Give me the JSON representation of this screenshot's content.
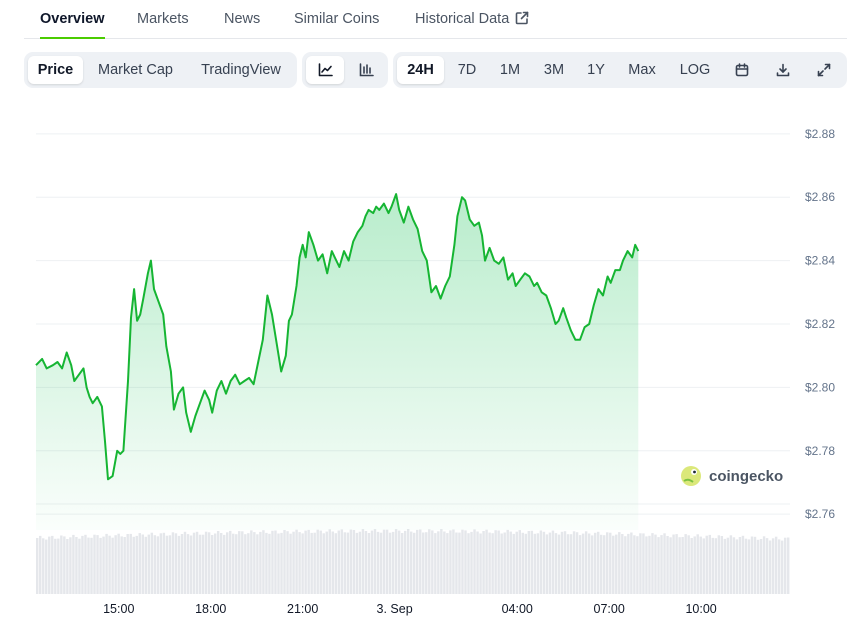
{
  "tabs": [
    {
      "label": "Overview",
      "active": true
    },
    {
      "label": "Markets",
      "active": false
    },
    {
      "label": "News",
      "active": false
    },
    {
      "label": "Similar Coins",
      "active": false
    },
    {
      "label": "Historical Data",
      "active": false,
      "external": true
    }
  ],
  "toolbar": {
    "chart_types": [
      {
        "label": "Price",
        "active": true
      },
      {
        "label": "Market Cap",
        "active": false
      },
      {
        "label": "TradingView",
        "active": false
      }
    ],
    "views": [
      {
        "icon": "line-chart-icon",
        "active": true
      },
      {
        "icon": "candlestick-chart-icon",
        "active": false
      }
    ],
    "ranges": [
      {
        "label": "24H",
        "active": true
      },
      {
        "label": "7D",
        "active": false
      },
      {
        "label": "1M",
        "active": false
      },
      {
        "label": "3M",
        "active": false
      },
      {
        "label": "1Y",
        "active": false
      },
      {
        "label": "Max",
        "active": false
      },
      {
        "label": "LOG",
        "active": false
      }
    ],
    "actions": [
      "calendar-icon",
      "download-icon",
      "fullscreen-icon"
    ]
  },
  "watermark": "coingecko",
  "colors": {
    "line": "#16b533",
    "accent": "#4bcc00",
    "volume": "#e5e7eb"
  },
  "chart_data": {
    "type": "area",
    "title": "",
    "xlabel": "",
    "ylabel": "",
    "ylim": [
      2.755,
      2.885
    ],
    "yticks": [
      {
        "value": 2.88,
        "label": "$2.88"
      },
      {
        "value": 2.86,
        "label": "$2.86"
      },
      {
        "value": 2.84,
        "label": "$2.84"
      },
      {
        "value": 2.82,
        "label": "$2.82"
      },
      {
        "value": 2.8,
        "label": "$2.80"
      },
      {
        "value": 2.78,
        "label": "$2.78"
      },
      {
        "value": 2.76,
        "label": "$2.76"
      }
    ],
    "xlim": [
      12.3,
      36.9
    ],
    "xticks": [
      {
        "value": 15,
        "label": "15:00"
      },
      {
        "value": 18,
        "label": "18:00"
      },
      {
        "value": 21,
        "label": "21:00"
      },
      {
        "value": 24,
        "label": "3. Sep"
      },
      {
        "value": 28,
        "label": "04:00"
      },
      {
        "value": 31,
        "label": "07:00"
      },
      {
        "value": 34,
        "label": "10:00"
      }
    ],
    "grid": true,
    "series": [
      {
        "values": [
          [
            12.3,
            2.807
          ],
          [
            12.5,
            2.809
          ],
          [
            12.65,
            2.806
          ],
          [
            12.85,
            2.807
          ],
          [
            13.0,
            2.808
          ],
          [
            13.15,
            2.806
          ],
          [
            13.3,
            2.811
          ],
          [
            13.45,
            2.807
          ],
          [
            13.55,
            2.802
          ],
          [
            13.7,
            2.804
          ],
          [
            13.85,
            2.806
          ],
          [
            13.95,
            2.8
          ],
          [
            14.05,
            2.797
          ],
          [
            14.15,
            2.795
          ],
          [
            14.3,
            2.797
          ],
          [
            14.45,
            2.794
          ],
          [
            14.55,
            2.783
          ],
          [
            14.65,
            2.771
          ],
          [
            14.8,
            2.772
          ],
          [
            14.95,
            2.78
          ],
          [
            15.05,
            2.779
          ],
          [
            15.15,
            2.78
          ],
          [
            15.3,
            2.802
          ],
          [
            15.4,
            2.822
          ],
          [
            15.5,
            2.831
          ],
          [
            15.6,
            2.821
          ],
          [
            15.7,
            2.823
          ],
          [
            15.8,
            2.828
          ],
          [
            15.95,
            2.836
          ],
          [
            16.05,
            2.84
          ],
          [
            16.15,
            2.831
          ],
          [
            16.3,
            2.827
          ],
          [
            16.45,
            2.823
          ],
          [
            16.55,
            2.813
          ],
          [
            16.7,
            2.805
          ],
          [
            16.8,
            2.793
          ],
          [
            16.95,
            2.798
          ],
          [
            17.1,
            2.8
          ],
          [
            17.2,
            2.792
          ],
          [
            17.35,
            2.786
          ],
          [
            17.5,
            2.791
          ],
          [
            17.65,
            2.795
          ],
          [
            17.8,
            2.799
          ],
          [
            17.95,
            2.796
          ],
          [
            18.05,
            2.792
          ],
          [
            18.2,
            2.799
          ],
          [
            18.35,
            2.802
          ],
          [
            18.5,
            2.798
          ],
          [
            18.65,
            2.802
          ],
          [
            18.8,
            2.804
          ],
          [
            18.95,
            2.801
          ],
          [
            19.1,
            2.802
          ],
          [
            19.25,
            2.803
          ],
          [
            19.4,
            2.801
          ],
          [
            19.55,
            2.808
          ],
          [
            19.7,
            2.815
          ],
          [
            19.85,
            2.829
          ],
          [
            20.0,
            2.823
          ],
          [
            20.15,
            2.814
          ],
          [
            20.3,
            2.805
          ],
          [
            20.45,
            2.81
          ],
          [
            20.55,
            2.821
          ],
          [
            20.65,
            2.823
          ],
          [
            20.8,
            2.832
          ],
          [
            20.9,
            2.841
          ],
          [
            21.0,
            2.845
          ],
          [
            21.1,
            2.841
          ],
          [
            21.2,
            2.849
          ],
          [
            21.35,
            2.845
          ],
          [
            21.5,
            2.84
          ],
          [
            21.65,
            2.842
          ],
          [
            21.8,
            2.836
          ],
          [
            21.95,
            2.843
          ],
          [
            22.05,
            2.841
          ],
          [
            22.2,
            2.838
          ],
          [
            22.35,
            2.843
          ],
          [
            22.5,
            2.84
          ],
          [
            22.65,
            2.846
          ],
          [
            22.8,
            2.849
          ],
          [
            22.95,
            2.851
          ],
          [
            23.05,
            2.854
          ],
          [
            23.15,
            2.856
          ],
          [
            23.3,
            2.855
          ],
          [
            23.4,
            2.857
          ],
          [
            23.5,
            2.856
          ],
          [
            23.65,
            2.858
          ],
          [
            23.8,
            2.855
          ],
          [
            23.9,
            2.857
          ],
          [
            24.05,
            2.861
          ],
          [
            24.15,
            2.856
          ],
          [
            24.3,
            2.852
          ],
          [
            24.45,
            2.857
          ],
          [
            24.6,
            2.853
          ],
          [
            24.75,
            2.85
          ],
          [
            24.9,
            2.843
          ],
          [
            25.05,
            2.84
          ],
          [
            25.2,
            2.83
          ],
          [
            25.35,
            2.832
          ],
          [
            25.5,
            2.828
          ],
          [
            25.65,
            2.832
          ],
          [
            25.8,
            2.835
          ],
          [
            25.95,
            2.845
          ],
          [
            26.05,
            2.854
          ],
          [
            26.2,
            2.86
          ],
          [
            26.3,
            2.859
          ],
          [
            26.45,
            2.853
          ],
          [
            26.6,
            2.851
          ],
          [
            26.75,
            2.852
          ],
          [
            26.85,
            2.848
          ],
          [
            26.95,
            2.84
          ],
          [
            27.1,
            2.844
          ],
          [
            27.25,
            2.84
          ],
          [
            27.4,
            2.839
          ],
          [
            27.55,
            2.841
          ],
          [
            27.7,
            2.834
          ],
          [
            27.85,
            2.836
          ],
          [
            27.95,
            2.832
          ],
          [
            28.1,
            2.834
          ],
          [
            28.25,
            2.836
          ],
          [
            28.4,
            2.835
          ],
          [
            28.55,
            2.832
          ],
          [
            28.65,
            2.833
          ],
          [
            28.8,
            2.83
          ],
          [
            28.95,
            2.829
          ],
          [
            29.1,
            2.825
          ],
          [
            29.25,
            2.82
          ],
          [
            29.35,
            2.821
          ],
          [
            29.5,
            2.825
          ],
          [
            29.6,
            2.822
          ],
          [
            29.75,
            2.818
          ],
          [
            29.9,
            2.815
          ],
          [
            30.05,
            2.815
          ],
          [
            30.2,
            2.819
          ],
          [
            30.35,
            2.82
          ],
          [
            30.5,
            2.826
          ],
          [
            30.65,
            2.831
          ],
          [
            30.8,
            2.829
          ],
          [
            30.95,
            2.835
          ],
          [
            31.05,
            2.833
          ],
          [
            31.2,
            2.837
          ],
          [
            31.35,
            2.837
          ],
          [
            31.45,
            2.84
          ],
          [
            31.6,
            2.843
          ],
          [
            31.75,
            2.841
          ],
          [
            31.85,
            2.845
          ],
          [
            31.95,
            2.843
          ]
        ]
      }
    ]
  }
}
